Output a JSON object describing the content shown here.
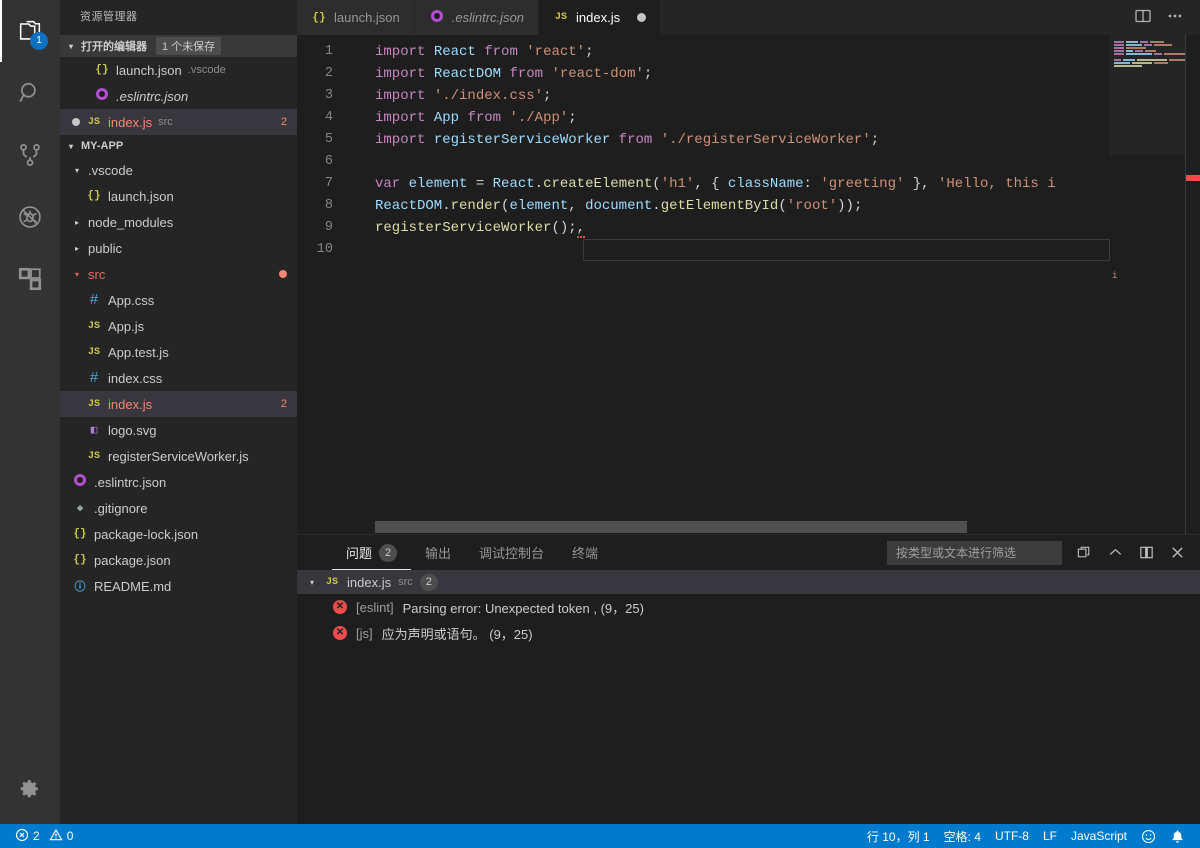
{
  "activitybar": {
    "items": [
      {
        "name": "explorer",
        "icon": "files-icon",
        "badge": "1",
        "active": true
      },
      {
        "name": "search",
        "icon": "search-icon",
        "badge": "",
        "active": false
      },
      {
        "name": "source-control",
        "icon": "source-control-icon",
        "badge": "",
        "active": false
      },
      {
        "name": "debug",
        "icon": "debug-icon",
        "badge": "",
        "active": false
      },
      {
        "name": "extensions",
        "icon": "extensions-icon",
        "badge": "",
        "active": false
      }
    ],
    "settings_icon": "gear-icon"
  },
  "sidebar": {
    "title": "资源管理器",
    "open_editors": {
      "label": "打开的编辑器",
      "badge": "1 个未保存",
      "items": [
        {
          "icon": "json-icon",
          "name": "launch.json",
          "sub": ".vscode",
          "dirty": false,
          "errors": "",
          "italic": false,
          "selected": false
        },
        {
          "icon": "eslint-icon",
          "name": ".eslintrc.json",
          "sub": "",
          "dirty": false,
          "errors": "",
          "italic": true,
          "selected": false
        },
        {
          "icon": "js-icon",
          "name": "index.js",
          "sub": "src",
          "dirty": true,
          "errors": "2",
          "italic": false,
          "selected": true
        }
      ]
    },
    "project": {
      "label": "MY-APP",
      "tree": [
        {
          "icon": "folder-icon",
          "name": ".vscode",
          "indent": 1,
          "expanded": true,
          "type": "folder"
        },
        {
          "icon": "json-icon",
          "name": "launch.json",
          "indent": 2,
          "type": "file"
        },
        {
          "icon": "folder-icon",
          "name": "node_modules",
          "indent": 1,
          "expanded": false,
          "type": "folder"
        },
        {
          "icon": "folder-icon",
          "name": "public",
          "indent": 1,
          "expanded": false,
          "type": "folder"
        },
        {
          "icon": "folder-icon",
          "name": "src",
          "indent": 1,
          "expanded": true,
          "type": "folder",
          "error_dot": true
        },
        {
          "icon": "css-icon",
          "name": "App.css",
          "indent": 2,
          "type": "file"
        },
        {
          "icon": "js-icon",
          "name": "App.js",
          "indent": 2,
          "type": "file"
        },
        {
          "icon": "js-icon",
          "name": "App.test.js",
          "indent": 2,
          "type": "file"
        },
        {
          "icon": "css-icon",
          "name": "index.css",
          "indent": 2,
          "type": "file"
        },
        {
          "icon": "js-icon",
          "name": "index.js",
          "indent": 2,
          "type": "file",
          "selected": true,
          "errors": "2"
        },
        {
          "icon": "svg-icon",
          "name": "logo.svg",
          "indent": 2,
          "type": "file"
        },
        {
          "icon": "js-icon",
          "name": "registerServiceWorker.js",
          "indent": 2,
          "type": "file"
        },
        {
          "icon": "eslint-icon",
          "name": ".eslintrc.json",
          "indent": 1,
          "type": "file"
        },
        {
          "icon": "git-icon",
          "name": ".gitignore",
          "indent": 1,
          "type": "file"
        },
        {
          "icon": "json-icon",
          "name": "package-lock.json",
          "indent": 1,
          "type": "file"
        },
        {
          "icon": "json-icon",
          "name": "package.json",
          "indent": 1,
          "type": "file"
        },
        {
          "icon": "md-icon",
          "name": "README.md",
          "indent": 1,
          "type": "file"
        }
      ]
    }
  },
  "editor": {
    "tabs": [
      {
        "icon": "json-icon",
        "label": "launch.json",
        "active": false,
        "dirty": false,
        "italic": false
      },
      {
        "icon": "eslint-icon",
        "label": ".eslintrc.json",
        "active": false,
        "dirty": false,
        "italic": true
      },
      {
        "icon": "js-icon",
        "label": "index.js",
        "active": true,
        "dirty": true,
        "italic": false
      }
    ],
    "actions": [
      {
        "name": "split-editor-icon",
        "label": "split-editor"
      },
      {
        "name": "more-actions-icon",
        "label": "more-actions"
      }
    ],
    "line_numbers": [
      "1",
      "2",
      "3",
      "4",
      "5",
      "6",
      "7",
      "8",
      "9",
      "10"
    ],
    "code": [
      {
        "n": "1",
        "tokens": [
          [
            "k",
            "import"
          ],
          [
            "pl",
            " "
          ],
          [
            "id",
            "React"
          ],
          [
            "pl",
            " "
          ],
          [
            "k",
            "from"
          ],
          [
            "pl",
            " "
          ],
          [
            "str",
            "'react'"
          ],
          [
            "pl",
            ";"
          ]
        ]
      },
      {
        "n": "2",
        "tokens": [
          [
            "k",
            "import"
          ],
          [
            "pl",
            " "
          ],
          [
            "id",
            "ReactDOM"
          ],
          [
            "pl",
            " "
          ],
          [
            "k",
            "from"
          ],
          [
            "pl",
            " "
          ],
          [
            "str",
            "'react-dom'"
          ],
          [
            "pl",
            ";"
          ]
        ]
      },
      {
        "n": "3",
        "tokens": [
          [
            "k",
            "import"
          ],
          [
            "pl",
            " "
          ],
          [
            "str",
            "'./index.css'"
          ],
          [
            "pl",
            ";"
          ]
        ]
      },
      {
        "n": "4",
        "tokens": [
          [
            "k",
            "import"
          ],
          [
            "pl",
            " "
          ],
          [
            "id",
            "App"
          ],
          [
            "pl",
            " "
          ],
          [
            "k",
            "from"
          ],
          [
            "pl",
            " "
          ],
          [
            "str",
            "'./App'"
          ],
          [
            "pl",
            ";"
          ]
        ]
      },
      {
        "n": "5",
        "tokens": [
          [
            "k",
            "import"
          ],
          [
            "pl",
            " "
          ],
          [
            "id",
            "registerServiceWorker"
          ],
          [
            "pl",
            " "
          ],
          [
            "k",
            "from"
          ],
          [
            "pl",
            " "
          ],
          [
            "str",
            "'./registerServiceWorker'"
          ],
          [
            "pl",
            ";"
          ]
        ]
      },
      {
        "n": "6",
        "tokens": []
      },
      {
        "n": "7",
        "tokens": [
          [
            "k",
            "var"
          ],
          [
            "pl",
            " "
          ],
          [
            "id",
            "element"
          ],
          [
            "pl",
            " = "
          ],
          [
            "id",
            "React"
          ],
          [
            "pl",
            "."
          ],
          [
            "fn",
            "createElement"
          ],
          [
            "pl",
            "("
          ],
          [
            "str",
            "'h1'"
          ],
          [
            "pl",
            ", { "
          ],
          [
            "id",
            "className"
          ],
          [
            "pl",
            ": "
          ],
          [
            "str",
            "'greeting'"
          ],
          [
            "pl",
            " }, "
          ],
          [
            "str",
            "'Hello, this i"
          ]
        ]
      },
      {
        "n": "8",
        "tokens": [
          [
            "id",
            "ReactDOM"
          ],
          [
            "pl",
            "."
          ],
          [
            "fn",
            "render"
          ],
          [
            "pl",
            "("
          ],
          [
            "id",
            "element"
          ],
          [
            "pl",
            ", "
          ],
          [
            "id",
            "document"
          ],
          [
            "pl",
            "."
          ],
          [
            "fn",
            "getElementById"
          ],
          [
            "pl",
            "("
          ],
          [
            "str",
            "'root'"
          ],
          [
            "pl",
            "));"
          ]
        ]
      },
      {
        "n": "9",
        "tokens": [
          [
            "fn",
            "registerServiceWorker"
          ],
          [
            "pl",
            "();"
          ],
          [
            "err",
            ","
          ]
        ]
      },
      {
        "n": "10",
        "tokens": []
      }
    ],
    "minimap_label": "minimap"
  },
  "panel": {
    "tabs": [
      {
        "label": "问题",
        "badge": "2",
        "active": true
      },
      {
        "label": "输出",
        "badge": "",
        "active": false
      },
      {
        "label": "调试控制台",
        "badge": "",
        "active": false
      },
      {
        "label": "终端",
        "badge": "",
        "active": false
      }
    ],
    "filter_placeholder": "按类型或文本进行筛选",
    "filter_value": "",
    "actions": [
      {
        "name": "clear-icon",
        "label": "clear"
      },
      {
        "name": "chevron-up-icon",
        "label": "collapse"
      },
      {
        "name": "maximize-panel-icon",
        "label": "maximize"
      },
      {
        "name": "close-panel-icon",
        "label": "close"
      }
    ],
    "problems": {
      "file": {
        "icon": "js-icon",
        "name": "index.js",
        "sub": "src",
        "count": "2"
      },
      "rows": [
        {
          "source": "[eslint]",
          "message": "Parsing error: Unexpected token , (9，25)"
        },
        {
          "source": "[js]",
          "message": "应为声明或语句。 (9，25)"
        }
      ]
    }
  },
  "statusbar": {
    "errors": "2",
    "warnings": "0",
    "right_items": [
      {
        "name": "cursor-position",
        "label": "行 10，列 1"
      },
      {
        "name": "indentation",
        "label": "空格: 4"
      },
      {
        "name": "encoding",
        "label": "UTF-8"
      },
      {
        "name": "eol",
        "label": "LF"
      },
      {
        "name": "language-mode",
        "label": "JavaScript"
      },
      {
        "name": "feedback-smiley-icon",
        "label": "☺"
      },
      {
        "name": "notifications-bell-icon",
        "label": "🔔"
      }
    ]
  },
  "colors": {
    "accent": "#007acc",
    "activitybar_bg": "#333333",
    "sidebar_bg": "#252526",
    "editor_bg": "#1e1e1e",
    "error": "#f14c4c",
    "error_text": "#f48771",
    "badge_blue": "#0e70c0"
  }
}
